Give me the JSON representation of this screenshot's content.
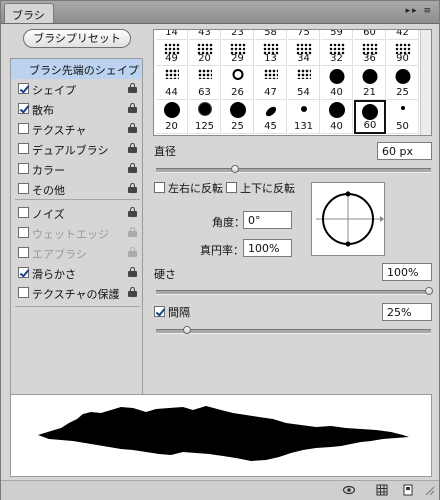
{
  "panel": {
    "tab_label": "ブラシ",
    "menu_glyphs": "▸▸ ≡"
  },
  "left": {
    "preset_button": "ブラシプリセット",
    "options": [
      {
        "label": "ブラシ先端のシェイプ",
        "checkbox": false,
        "selected": true,
        "enabled": true
      },
      {
        "label": "シェイプ",
        "checkbox": true,
        "checked": true,
        "enabled": true
      },
      {
        "label": "散布",
        "checkbox": true,
        "checked": true,
        "enabled": true
      },
      {
        "label": "テクスチャ",
        "checkbox": true,
        "checked": false,
        "enabled": true
      },
      {
        "label": "デュアルブラシ",
        "checkbox": true,
        "checked": false,
        "enabled": true
      },
      {
        "label": "カラー",
        "checkbox": true,
        "checked": false,
        "enabled": true
      },
      {
        "label": "その他",
        "checkbox": true,
        "checked": false,
        "enabled": true
      },
      {
        "label": "ノイズ",
        "checkbox": true,
        "checked": false,
        "enabled": true
      },
      {
        "label": "ウェットエッジ",
        "checkbox": true,
        "checked": false,
        "enabled": false
      },
      {
        "label": "エアブラシ",
        "checkbox": true,
        "checked": false,
        "enabled": false
      },
      {
        "label": "滑らかさ",
        "checkbox": true,
        "checked": true,
        "enabled": true
      },
      {
        "label": "テクスチャの保護",
        "checkbox": true,
        "checked": false,
        "enabled": true
      }
    ]
  },
  "brush_grid": {
    "rows": [
      [
        "14",
        "43",
        "23",
        "58",
        "75",
        "59",
        "60",
        "42"
      ],
      [
        "49",
        "20",
        "29",
        "13",
        "34",
        "32",
        "36",
        "90"
      ],
      [
        "44",
        "63",
        "26",
        "47",
        "54",
        "40",
        "21",
        "25"
      ],
      [
        "20",
        "125",
        "25",
        "45",
        "131",
        "40",
        "60",
        "50"
      ]
    ],
    "selected_size": "60"
  },
  "tip": {
    "diameter_label": "直径",
    "diameter_value": "60 px",
    "flip_x_label": "左右に反転",
    "flip_y_label": "上下に反転",
    "angle_label": "角度：",
    "angle_value": "0°",
    "roundness_label": "真円率：",
    "roundness_value": "100%",
    "hardness_label": "硬さ",
    "hardness_value": "100%",
    "spacing_label": "間隔",
    "spacing_value": "25%",
    "spacing_checked": true
  }
}
